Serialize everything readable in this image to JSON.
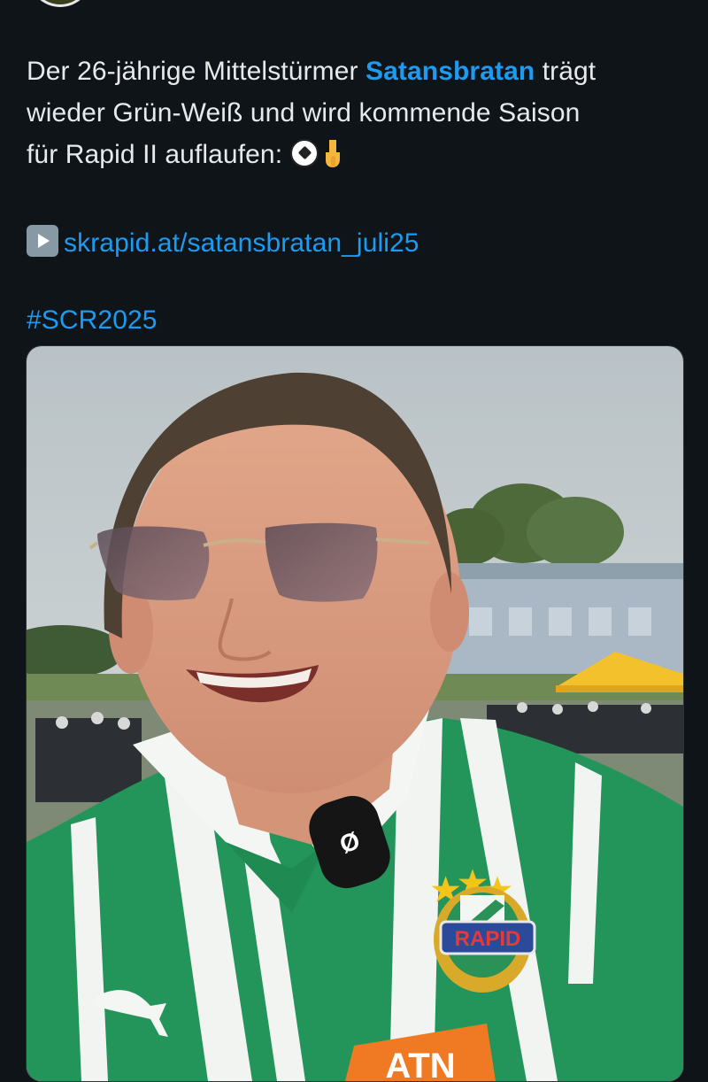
{
  "post": {
    "line1_pre": "Der 26-jährige Mittelstürmer ",
    "mention": "Satansbratan",
    "line1_post": " trägt",
    "line2": "wieder Grün-Weiß und wird kommende Saison",
    "line3": "für Rapid II auflaufen: ",
    "link_text": "skrapid.at/satansbratan_juli25",
    "hashtag": "#SCR2025"
  },
  "media": {
    "crest_label": "RAPID",
    "mic_label": "Ø",
    "brand_stamp": "ATN"
  },
  "colors": {
    "background": "#0f1419",
    "text": "#e7e9ea",
    "accent": "#1d9bf0"
  },
  "icons": [
    "soccer-ball-icon",
    "backhand-index-pointing-down-icon",
    "play-button-icon"
  ]
}
